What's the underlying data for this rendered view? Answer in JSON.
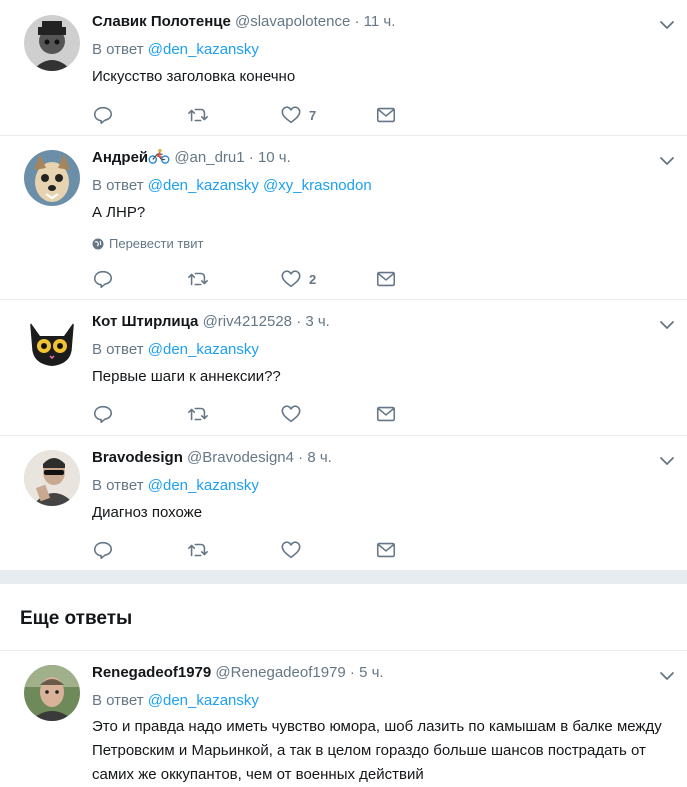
{
  "reply_prefix": "В ответ",
  "tweets": [
    {
      "name": "Славик Полотенце",
      "handle": "@slavapolotence",
      "separator": "·",
      "time": "11 ч.",
      "reply_to": [
        "@den_kazansky"
      ],
      "text": "Искусство заголовка конечно",
      "like_count": "7",
      "icon_names": [
        "reply-icon",
        "retweet-icon",
        "like-icon",
        "message-icon",
        "chevron-down-icon"
      ]
    },
    {
      "name": "Андрей",
      "name_emoji": "cyclist-icon",
      "handle": "@an_dru1",
      "separator": "·",
      "time": "10 ч.",
      "reply_to": [
        "@den_kazansky",
        "@xy_krasnodon"
      ],
      "text": "А ЛНР?",
      "translate_label": "Перевести твит",
      "like_count": "2"
    },
    {
      "name": "Кот Штирлица",
      "handle": "@riv4212528",
      "separator": "·",
      "time": "3 ч.",
      "reply_to": [
        "@den_kazansky"
      ],
      "text": "Первые шаги к аннексии??",
      "like_count": ""
    },
    {
      "name": "Bravodesign",
      "handle": "@Bravodesign4",
      "separator": "·",
      "time": "8 ч.",
      "reply_to": [
        "@den_kazansky"
      ],
      "text": "Диагноз похоже",
      "like_count": ""
    },
    {
      "name": "Renegadeof1979",
      "handle": "@Renegadeof1979",
      "separator": "·",
      "time": "5 ч.",
      "reply_to": [
        "@den_kazansky"
      ],
      "text": "Это и правда надо иметь чувство юмора, шоб лазить по камышам в балке между Петровским и Марьинкой, а так в целом гораздо больше шансов пострадать от самих же оккупантов, чем от военных действий"
    }
  ],
  "more_replies_title": "Еще ответы",
  "colors": {
    "link": "#1da1f2",
    "secondary": "#657786",
    "border": "#e6ecf0"
  }
}
